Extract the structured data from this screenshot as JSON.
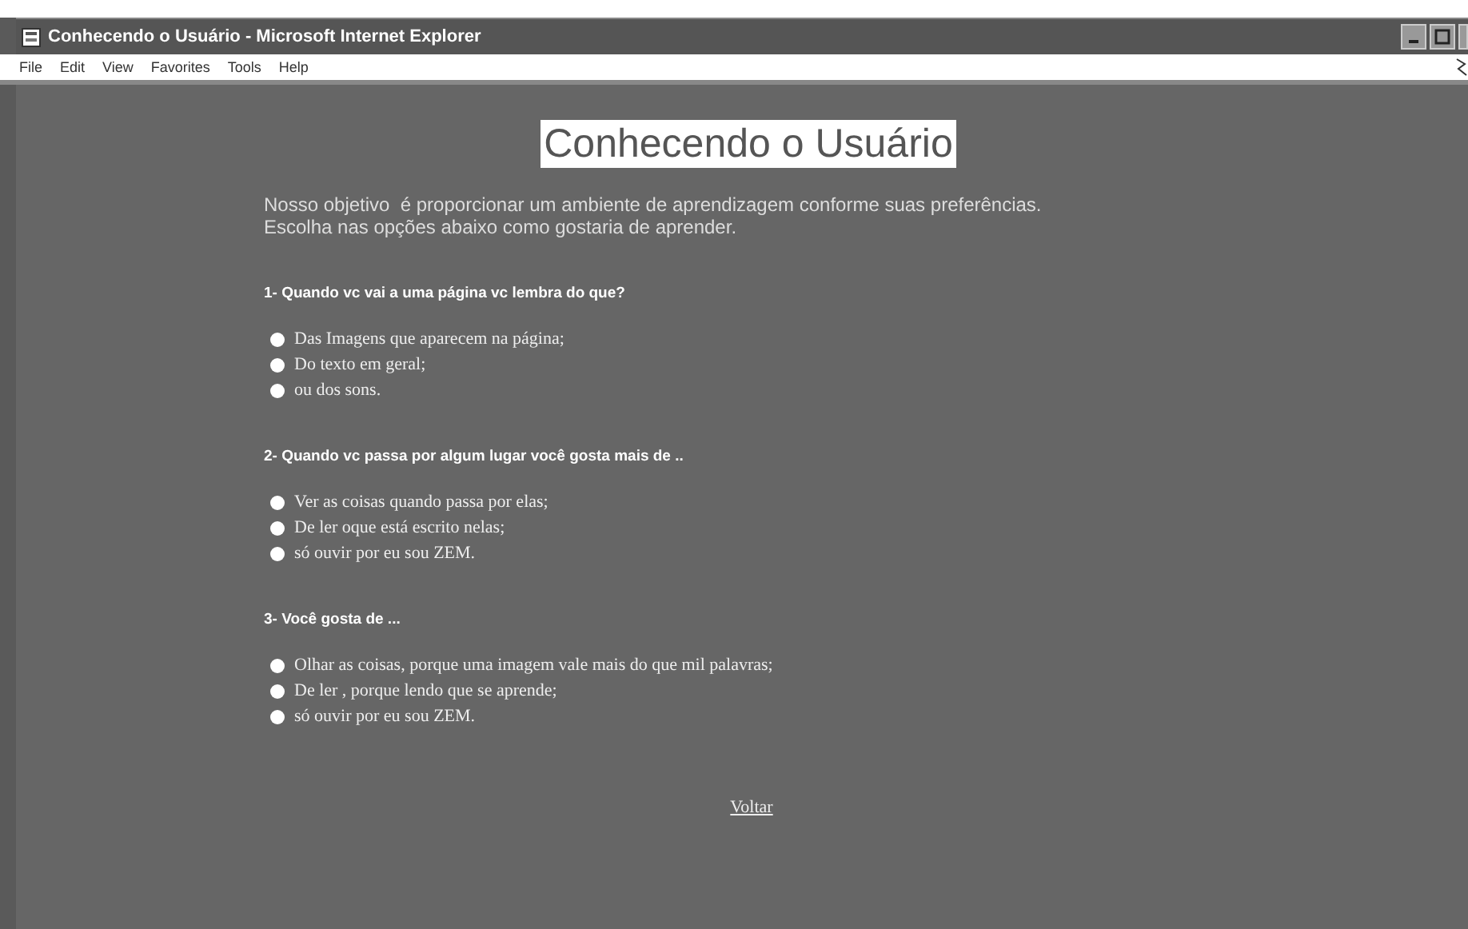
{
  "window": {
    "title": "Conhecendo o Usuário - Microsoft Internet Explorer"
  },
  "menu": [
    "File",
    "Edit",
    "View",
    "Favorites",
    "Tools",
    "Help"
  ],
  "page": {
    "heading": "Conhecendo o Usuário",
    "intro": [
      "Nosso objetivo  é proporcionar um ambiente de aprendizagem conforme suas preferências.",
      "Escolha nas opções abaixo como gostaria de aprender."
    ],
    "questions": [
      {
        "title": "1- Quando vc vai a uma página vc lembra do que?",
        "options": [
          "Das Imagens que aparecem na página;",
          "Do texto em geral;",
          "ou dos sons."
        ]
      },
      {
        "title": "2- Quando vc passa por algum lugar você gosta mais de ..",
        "options": [
          "Ver as coisas quando passa por elas;",
          "De ler oque está escrito nelas;",
          "só ouvir por eu sou ZEM."
        ]
      },
      {
        "title": "3- Você gosta de ...",
        "options": [
          "Olhar as coisas, porque uma imagem vale mais do que mil palavras;",
          "De ler , porque lendo que se aprende;",
          "só ouvir por eu sou ZEM."
        ]
      }
    ],
    "link": "Voltar"
  }
}
